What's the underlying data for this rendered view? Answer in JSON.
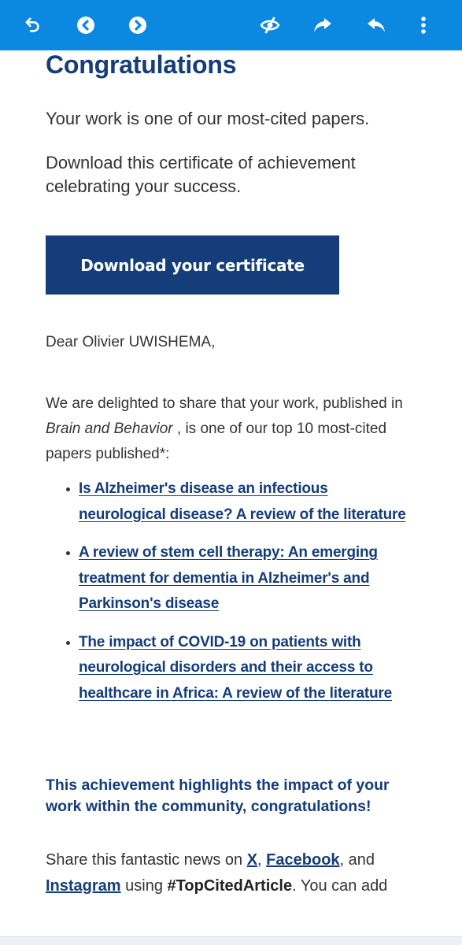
{
  "toolbar": {
    "background": "#0b88e0",
    "icons": [
      {
        "name": "undo-icon",
        "label": "Back"
      },
      {
        "name": "previous-icon",
        "label": "Previous"
      },
      {
        "name": "next-icon",
        "label": "Next"
      },
      {
        "name": "mark-unread-icon",
        "label": "Mark unread"
      },
      {
        "name": "forward-icon",
        "label": "Forward"
      },
      {
        "name": "reply-icon",
        "label": "Reply"
      },
      {
        "name": "more-options-icon",
        "label": "More options"
      }
    ]
  },
  "email": {
    "title": "Congratulations",
    "lead_1": "Your work is one of our most-cited papers.",
    "lead_2": "Download this certificate of achievement celebrating your success.",
    "download_button": "Download your certificate",
    "greeting": "Dear Olivier UWISHEMA,",
    "intro_part1": "We are delighted to share that your work, published in ",
    "journal": "Brain and Behavior",
    "intro_part2": " , is one of our top 10 most-cited papers published*:",
    "papers": [
      {
        "title": "Is Alzheimer's disease an infectious neurological disease? A review of the literature"
      },
      {
        "title": "A review of stem cell therapy: An emerging treatment for dementia in Alzheimer's and Parkinson's disease"
      },
      {
        "title": "The impact of COVID-19 on patients with neurological disorders and their access to healthcare in Africa: A review of the literature"
      }
    ],
    "highlight": "This achievement highlights the impact of your work within the community, congratulations!",
    "share": {
      "prefix": "Share this fantastic news on ",
      "x_link": "X",
      "sep1": ", ",
      "facebook_link": "Facebook",
      "sep2": ", and ",
      "instagram_link": "Instagram",
      "using": " using ",
      "hashtag": "#TopCitedArticle",
      "suffix": ". You can add"
    }
  },
  "colors": {
    "brand_navy": "#143d7a",
    "toolbar_blue": "#0b88e0",
    "body_text": "#333333"
  }
}
